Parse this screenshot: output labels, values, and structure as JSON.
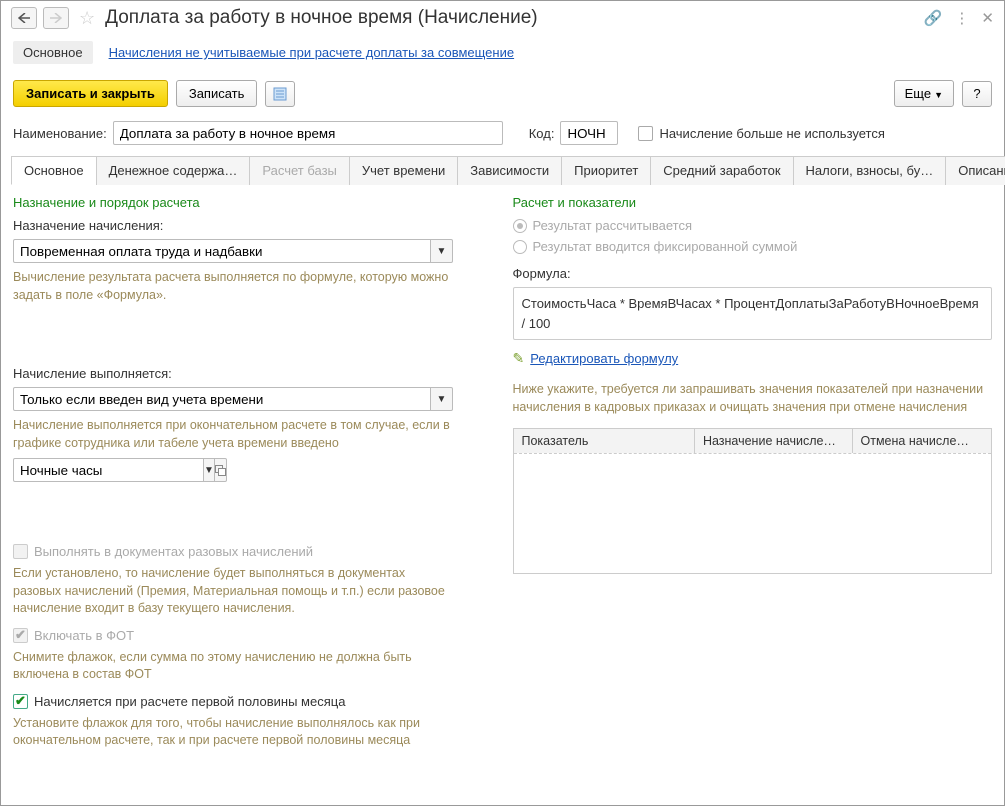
{
  "titlebar": {
    "title": "Доплата за работу в ночное время (Начисление)"
  },
  "navline": {
    "main": "Основное",
    "link": "Начисления не учитываемые при расчете доплаты за совмещение"
  },
  "toolbar": {
    "save_close": "Записать и закрыть",
    "save": "Записать",
    "more": "Еще",
    "help": "?"
  },
  "fields": {
    "name_label": "Наименование:",
    "name_value": "Доплата за работу в ночное время",
    "code_label": "Код:",
    "code_value": "НОЧН",
    "not_used": "Начисление больше не используется"
  },
  "tabs": [
    "Основное",
    "Денежное содержа…",
    "Расчет базы",
    "Учет времени",
    "Зависимости",
    "Приоритет",
    "Средний заработок",
    "Налоги, взносы, бу…",
    "Описание"
  ],
  "left": {
    "section1": "Назначение и порядок расчета",
    "assign_label": "Назначение начисления:",
    "assign_value": "Повременная оплата труда и надбавки",
    "assign_hint": "Вычисление результата расчета выполняется по формуле, которую можно задать в поле «Формула».",
    "exec_label": "Начисление выполняется:",
    "exec_value": "Только если введен вид учета времени",
    "exec_hint": "Начисление выполняется при окончательном расчете в том случае, если в графике сотрудника или табеле учета времени введено",
    "time_value": "Ночные часы",
    "cb1_label": "Выполнять в документах разовых начислений",
    "cb1_hint": "Если установлено, то начисление будет выполняться в документах разовых начислений (Премия, Материальная помощь и т.п.) если разовое начисление входит в базу текущего начисления.",
    "cb2_label": "Включать в ФОТ",
    "cb2_hint": "Снимите флажок, если сумма по этому начислению не должна быть включена в состав ФОТ",
    "cb3_label": "Начисляется при расчете первой половины месяца",
    "cb3_hint": "Установите флажок для того, чтобы начисление выполнялось как при окончательном расчете, так и при расчете первой половины месяца"
  },
  "right": {
    "section": "Расчет и показатели",
    "radio1": "Результат рассчитывается",
    "radio2": "Результат вводится фиксированной суммой",
    "formula_label": "Формула:",
    "formula_value": "СтоимостьЧаса * ВремяВЧасах * ПроцентДоплатыЗаРаботуВНочноеВремя / 100",
    "edit_link": "Редактировать формулу",
    "table_hint": "Ниже укажите, требуется ли запрашивать значения показателей при назначении начисления в кадровых приказах и очищать значения при отмене начисления",
    "th1": "Показатель",
    "th2": "Назначение начисле…",
    "th3": "Отмена начисле…"
  }
}
